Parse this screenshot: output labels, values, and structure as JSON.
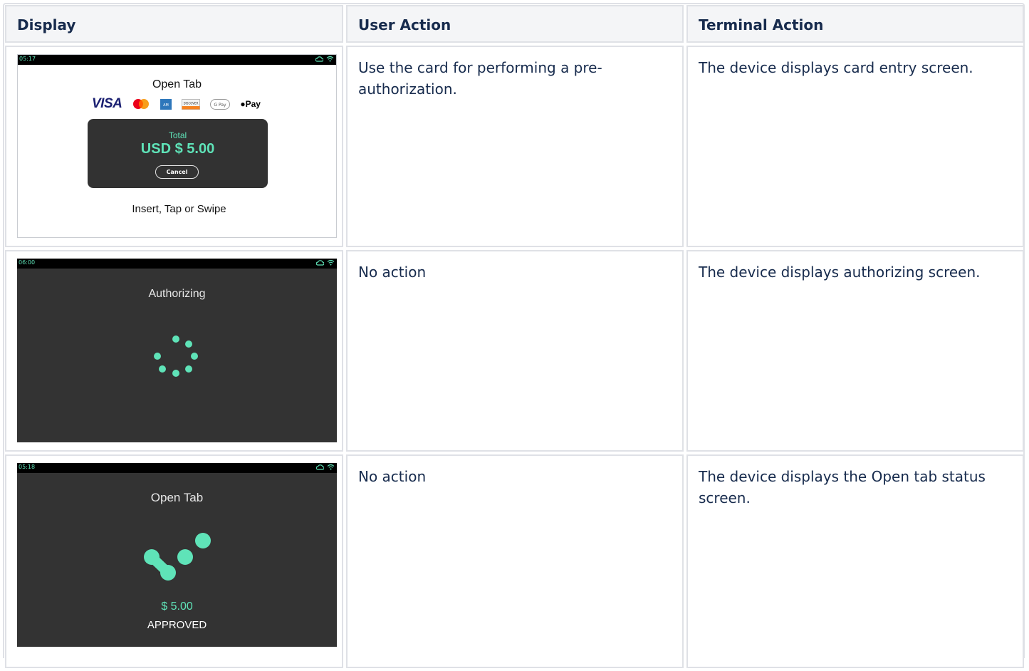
{
  "table": {
    "headers": [
      "Display",
      "User Action",
      "Terminal Action"
    ],
    "rows": [
      {
        "display": {
          "time": "05:17",
          "title": "Open Tab",
          "card_logos": [
            "VISA",
            "mastercard-icon",
            "amex-icon",
            "DISCOVER",
            "G Pay",
            "Pay"
          ],
          "total_label": "Total",
          "amount": "USD $ 5.00",
          "cancel_label": "Cancel",
          "prompt": "Insert, Tap or Swipe"
        },
        "user_action": "Use the card for performing a pre-authorization.",
        "terminal_action": "The device displays card entry screen."
      },
      {
        "display": {
          "time": "06:00",
          "title": "Authorizing"
        },
        "user_action": "No action",
        "terminal_action": "The device displays authorizing screen."
      },
      {
        "display": {
          "time": "05:18",
          "title": "Open Tab",
          "amount": "$ 5.00",
          "status": "APPROVED"
        },
        "user_action": "No action",
        "terminal_action": "The device displays the Open tab status screen."
      }
    ]
  },
  "colors": {
    "accent": "#5fe3b8",
    "screen_dark": "#333333",
    "border": "#dfe1e6",
    "header_bg": "#f4f5f7"
  }
}
